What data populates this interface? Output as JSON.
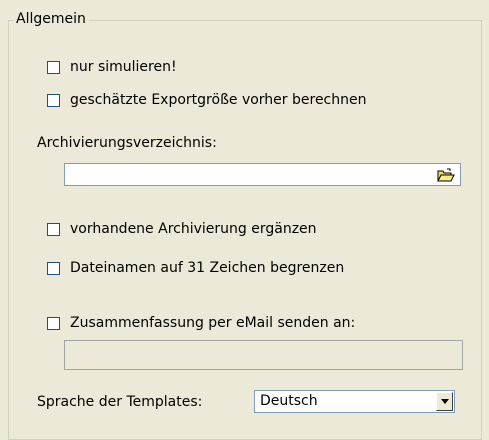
{
  "group": {
    "legend": "Allgemein"
  },
  "options": {
    "simulate": {
      "label": "nur simulieren!",
      "checked": false
    },
    "estimate_size": {
      "label": "geschätzte Exportgröße vorher berechnen",
      "checked": false
    },
    "archive_dir_label": "Archivierungsverzeichnis:",
    "archive_dir_value": "",
    "extend_archive": {
      "label": "vorhandene Archivierung ergänzen",
      "checked": false
    },
    "limit_filenames": {
      "label": "Dateinamen auf 31 Zeichen begrenzen",
      "checked": false
    },
    "send_summary": {
      "label": "Zusammenfassung per eMail senden an:",
      "checked": false
    },
    "email_value": ""
  },
  "templates": {
    "label": "Sprache der Templates:",
    "selected": "Deutsch"
  },
  "colors": {
    "background": "#ece9d8",
    "checkbox_border": "#1c5180",
    "input_border": "#7f9db9"
  },
  "icons": {
    "folder": "folder-open-icon",
    "dropdown": "chevron-down-icon"
  }
}
